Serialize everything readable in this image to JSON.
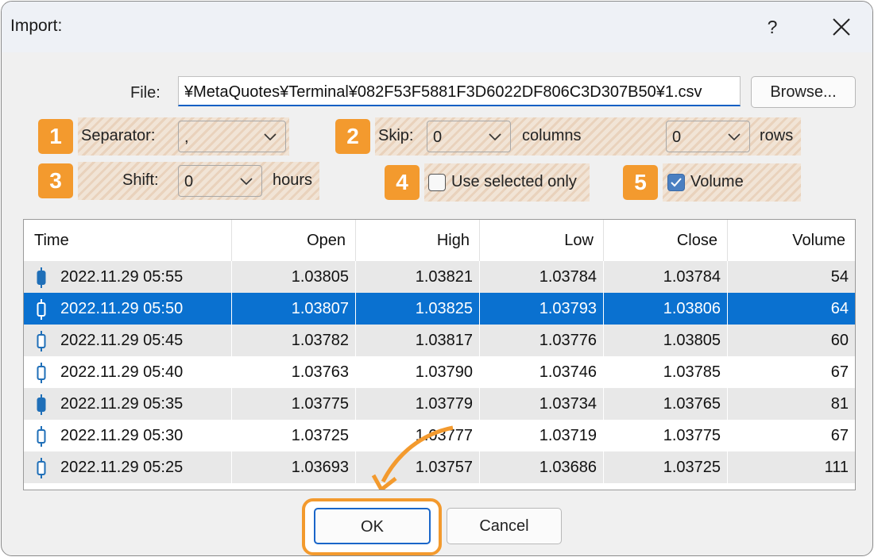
{
  "dialog": {
    "title": "Import:",
    "help_label": "?"
  },
  "file": {
    "label": "File:",
    "value": "¥MetaQuotes¥Terminal¥082F53F5881F3D6022DF806C3D307B50¥1.csv",
    "browse_label": "Browse..."
  },
  "badges": [
    "1",
    "2",
    "3",
    "4",
    "5"
  ],
  "separator": {
    "label": "Separator:",
    "value": ","
  },
  "skip": {
    "label": "Skip:",
    "columns_value": "0",
    "columns_label": "columns",
    "rows_value": "0",
    "rows_label": "rows"
  },
  "shift": {
    "label": "Shift:",
    "value": "0",
    "unit": "hours"
  },
  "use_selected": {
    "label": "Use selected only",
    "checked": false
  },
  "volume": {
    "label": "Volume",
    "checked": true
  },
  "table": {
    "columns": [
      "Time",
      "Open",
      "High",
      "Low",
      "Close",
      "Volume"
    ],
    "rows": [
      {
        "time": "2022.11.29 05:55",
        "open": "1.03805",
        "high": "1.03821",
        "low": "1.03784",
        "close": "1.03784",
        "volume": "54",
        "candle": "bear"
      },
      {
        "time": "2022.11.29 05:50",
        "open": "1.03807",
        "high": "1.03825",
        "low": "1.03793",
        "close": "1.03806",
        "volume": "64",
        "candle": "bear"
      },
      {
        "time": "2022.11.29 05:45",
        "open": "1.03782",
        "high": "1.03817",
        "low": "1.03776",
        "close": "1.03805",
        "volume": "60",
        "candle": "bull"
      },
      {
        "time": "2022.11.29 05:40",
        "open": "1.03763",
        "high": "1.03790",
        "low": "1.03746",
        "close": "1.03785",
        "volume": "67",
        "candle": "bull"
      },
      {
        "time": "2022.11.29 05:35",
        "open": "1.03775",
        "high": "1.03779",
        "low": "1.03734",
        "close": "1.03765",
        "volume": "81",
        "candle": "bear"
      },
      {
        "time": "2022.11.29 05:30",
        "open": "1.03725",
        "high": "1.03777",
        "low": "1.03719",
        "close": "1.03775",
        "volume": "67",
        "candle": "bull"
      },
      {
        "time": "2022.11.29 05:25",
        "open": "1.03693",
        "high": "1.03757",
        "low": "1.03686",
        "close": "1.03725",
        "volume": "111",
        "candle": "bull"
      }
    ],
    "selected_row": 1
  },
  "buttons": {
    "ok": "OK",
    "cancel": "Cancel"
  },
  "colors": {
    "accent_orange": "#f39a2e",
    "selection_blue": "#0a71d0",
    "candle_blue": "#1f6fb8"
  }
}
